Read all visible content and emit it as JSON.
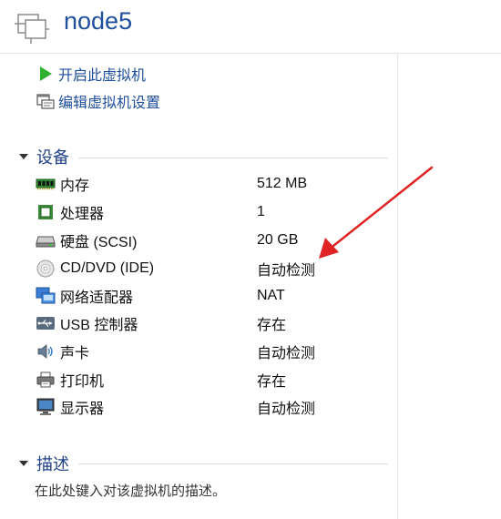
{
  "header": {
    "title": "node5",
    "icon": "vm-icon"
  },
  "actions": [
    {
      "label": "开启此虚拟机",
      "icon": "play-icon"
    },
    {
      "label": "编辑虚拟机设置",
      "icon": "edit-settings-icon"
    }
  ],
  "devices_section": {
    "title": "设备",
    "items": [
      {
        "name": "内存",
        "value": "512 MB",
        "icon": "memory-icon"
      },
      {
        "name": "处理器",
        "value": "1",
        "icon": "processor-icon"
      },
      {
        "name": "硬盘 (SCSI)",
        "value": "20 GB",
        "icon": "hard-disk-icon"
      },
      {
        "name": "CD/DVD (IDE)",
        "value": "自动检测",
        "icon": "cd-dvd-icon"
      },
      {
        "name": "网络适配器",
        "value": "NAT",
        "icon": "network-adapter-icon"
      },
      {
        "name": "USB 控制器",
        "value": "存在",
        "icon": "usb-icon"
      },
      {
        "name": "声卡",
        "value": "自动检测",
        "icon": "sound-card-icon"
      },
      {
        "name": "打印机",
        "value": "存在",
        "icon": "printer-icon"
      },
      {
        "name": "显示器",
        "value": "自动检测",
        "icon": "display-icon"
      }
    ]
  },
  "description_section": {
    "title": "描述",
    "placeholder": "在此处键入对该虚拟机的描述。"
  },
  "colors": {
    "title": "#1f4e9c",
    "play": "#2fb12f",
    "arrow": "#e02424"
  }
}
